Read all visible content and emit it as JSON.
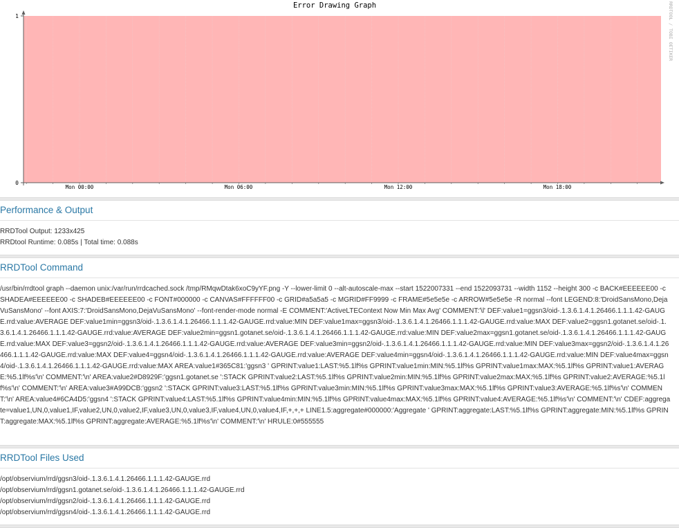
{
  "graph": {
    "title": "Error Drawing Graph",
    "side_label": "RRDTOOL / TOBI OETIKER",
    "y_ticks": [
      "1",
      "0"
    ],
    "x_ticks": [
      "Mon 00:00",
      "Mon 06:00",
      "Mon 12:00",
      "Mon 18:00"
    ],
    "colors": {
      "error_area": "#ffb6b6",
      "grid": "#efcaca",
      "axis": "#5e5e5e",
      "back": "#ffffff"
    }
  },
  "performance": {
    "title": "Performance & Output",
    "output": "RRDTool Output: 1233x425",
    "runtime": "RRDtool Runtime: 0.085s | Total time: 0.088s"
  },
  "command": {
    "title": "RRDTool Command",
    "text": "/usr/bin/rrdtool graph --daemon unix:/var/run/rrdcached.sock /tmp/RMqwDtak6xoC9yYF.png -Y --lower-limit 0 --alt-autoscale-max --start 1522007331 --end 1522093731 --width 1152 --height 300 -c BACK#EEEEEE00 -c SHADEA#EEEEEE00 -c SHADEB#EEEEEE00 -c FONT#000000 -c CANVAS#FFFFFF00 -c GRID#a5a5a5 -c MGRID#FF9999 -c FRAME#5e5e5e -c ARROW#5e5e5e -R normal --font LEGEND:8:'DroidSansMono,DejaVuSansMono' --font AXIS:7:'DroidSansMono,DejaVuSansMono' --font-render-mode normal -E COMMENT:'ActiveLTEContext Now Min Max Avg' COMMENT:'\\l' DEF:value1=ggsn3/oid-.1.3.6.1.4.1.26466.1.1.1.42-GAUGE.rrd:value:AVERAGE DEF:value1min=ggsn3/oid-.1.3.6.1.4.1.26466.1.1.1.42-GAUGE.rrd:value:MIN DEF:value1max=ggsn3/oid-.1.3.6.1.4.1.26466.1.1.1.42-GAUGE.rrd:value:MAX DEF:value2=ggsn1.gotanet.se/oid-.1.3.6.1.4.1.26466.1.1.1.42-GAUGE.rrd:value:AVERAGE DEF:value2min=ggsn1.gotanet.se/oid-.1.3.6.1.4.1.26466.1.1.1.42-GAUGE.rrd:value:MIN DEF:value2max=ggsn1.gotanet.se/oid-.1.3.6.1.4.1.26466.1.1.1.42-GAUGE.rrd:value:MAX DEF:value3=ggsn2/oid-.1.3.6.1.4.1.26466.1.1.1.42-GAUGE.rrd:value:AVERAGE DEF:value3min=ggsn2/oid-.1.3.6.1.4.1.26466.1.1.1.42-GAUGE.rrd:value:MIN DEF:value3max=ggsn2/oid-.1.3.6.1.4.1.26466.1.1.1.42-GAUGE.rrd:value:MAX DEF:value4=ggsn4/oid-.1.3.6.1.4.1.26466.1.1.1.42-GAUGE.rrd:value:AVERAGE DEF:value4min=ggsn4/oid-.1.3.6.1.4.1.26466.1.1.1.42-GAUGE.rrd:value:MIN DEF:value4max=ggsn4/oid-.1.3.6.1.4.1.26466.1.1.1.42-GAUGE.rrd:value:MAX AREA:value1#365C81:'ggsn3 ' GPRINT:value1:LAST:%5.1lf%s GPRINT:value1min:MIN:%5.1lf%s GPRINT:value1max:MAX:%5.1lf%s GPRINT:value1:AVERAGE:%5.1lf%s'\\n' COMMENT:'\\n' AREA:value2#D8929F:'ggsn1.gotanet.se ':STACK GPRINT:value2:LAST:%5.1lf%s GPRINT:value2min:MIN:%5.1lf%s GPRINT:value2max:MAX:%5.1lf%s GPRINT:value2:AVERAGE:%5.1lf%s'\\n' COMMENT:'\\n' AREA:value3#A99DCB:'ggsn2 ':STACK GPRINT:value3:LAST:%5.1lf%s GPRINT:value3min:MIN:%5.1lf%s GPRINT:value3max:MAX:%5.1lf%s GPRINT:value3:AVERAGE:%5.1lf%s'\\n' COMMENT:'\\n' AREA:value4#6CA4D5:'ggsn4 ':STACK GPRINT:value4:LAST:%5.1lf%s GPRINT:value4min:MIN:%5.1lf%s GPRINT:value4max:MAX:%5.1lf%s GPRINT:value4:AVERAGE:%5.1lf%s'\\n' COMMENT:'\\n' CDEF:aggregate=value1,UN,0,value1,IF,value2,UN,0,value2,IF,value3,UN,0,value3,IF,value4,UN,0,value4,IF,+,+,+ LINE1.5:aggregate#000000:'Aggregate ' GPRINT:aggregate:LAST:%5.1lf%s GPRINT:aggregate:MIN:%5.1lf%s GPRINT:aggregate:MAX:%5.1lf%s GPRINT:aggregate:AVERAGE:%5.1lf%s'\\n' COMMENT:'\\n' HRULE:0#555555"
  },
  "files": {
    "title": "RRDTool Files Used",
    "items": [
      "/opt/observium/rrd/ggsn3/oid-.1.3.6.1.4.1.26466.1.1.1.42-GAUGE.rrd",
      "/opt/observium/rrd/ggsn1.gotanet.se/oid-.1.3.6.1.4.1.26466.1.1.1.42-GAUGE.rrd",
      "/opt/observium/rrd/ggsn2/oid-.1.3.6.1.4.1.26466.1.1.1.42-GAUGE.rrd",
      "/opt/observium/rrd/ggsn4/oid-.1.3.6.1.4.1.26466.1.1.1.42-GAUGE.rrd"
    ]
  }
}
